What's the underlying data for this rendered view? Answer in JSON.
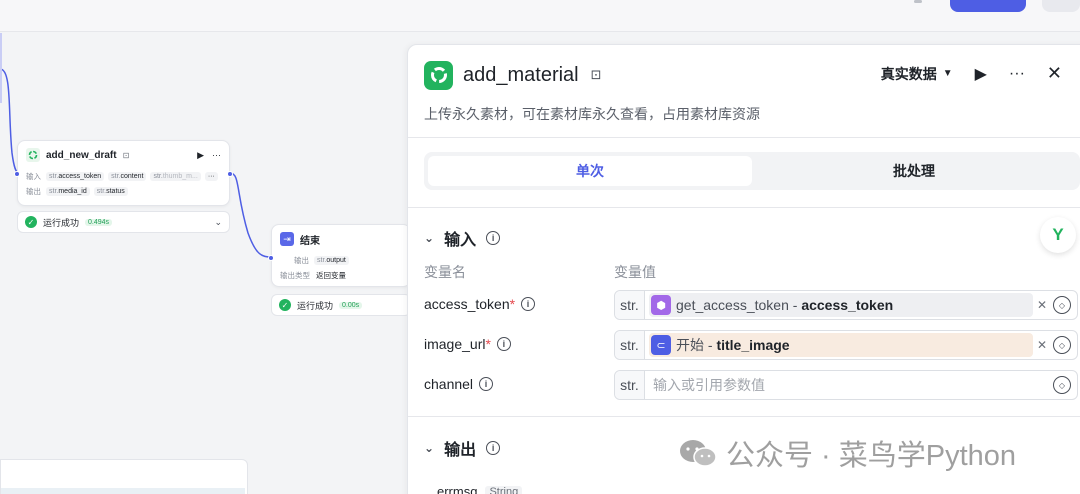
{
  "canvas": {
    "node_new_draft": {
      "title": "add_new_draft",
      "input_label": "输入",
      "output_label": "输出",
      "inputs": [
        {
          "type": "str.",
          "name": "access_token"
        },
        {
          "type": "str.",
          "name": "content"
        },
        {
          "type": "str.",
          "name": "thumb_m..."
        }
      ],
      "outputs": [
        {
          "type": "str.",
          "name": "media_id"
        },
        {
          "type": "str.",
          "name": "status"
        }
      ],
      "status_text": "运行成功",
      "time": "0.494s"
    },
    "node_end": {
      "title": "结束",
      "output_label": "输出",
      "output": {
        "type": "str.",
        "name": "output"
      },
      "output_type_label": "输出类型",
      "output_type_value": "返回变量",
      "status_text": "运行成功",
      "time": "0.00s"
    }
  },
  "panel": {
    "title": "add_material",
    "description": "上传永久素材，可在素材库永久查看，占用素材库资源",
    "mode": "真实数据",
    "tabs": [
      {
        "label": "单次",
        "active": true
      },
      {
        "label": "批处理",
        "active": false
      }
    ],
    "input_section": {
      "title": "输入",
      "col_name": "变量名",
      "col_value": "变量值",
      "rows": [
        {
          "name": "access_token",
          "required": "*",
          "type": "str.",
          "ref_source": "get_access_token",
          "ref_sep": " - ",
          "ref_field": "access_token"
        },
        {
          "name": "image_url",
          "required": "*",
          "type": "str.",
          "ref_source": "开始",
          "ref_sep": " - ",
          "ref_field": "title_image"
        },
        {
          "name": "channel",
          "required": "",
          "type": "str.",
          "placeholder": "输入或引用参数值"
        }
      ]
    },
    "output_section": {
      "title": "输出",
      "first_field": "errmsg",
      "first_type": "String"
    }
  },
  "watermark": {
    "text": "公众号 · 菜鸟学Python"
  },
  "colors": {
    "accent": "#4e5ee4",
    "success": "#22b35e",
    "required": "#e5484d"
  }
}
